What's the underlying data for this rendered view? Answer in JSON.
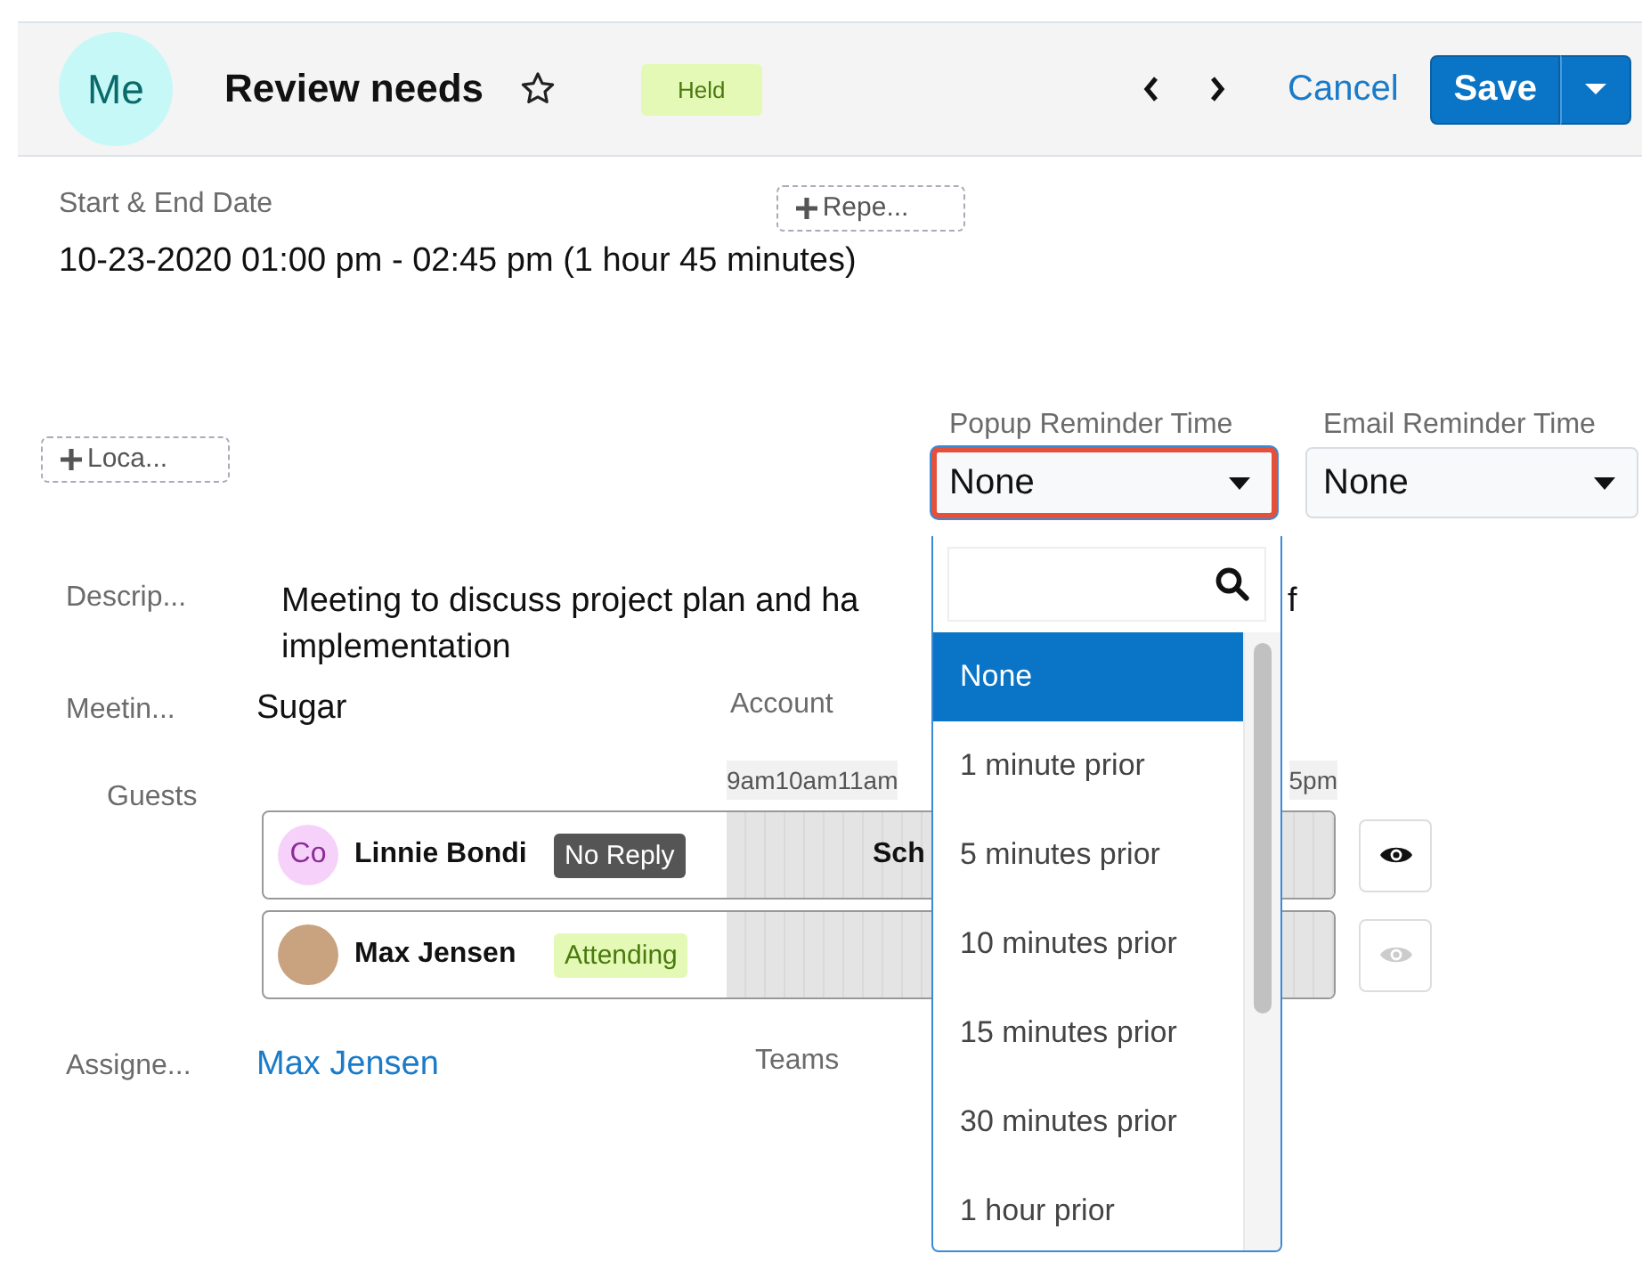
{
  "header": {
    "avatar": "Me",
    "title": "Review needs",
    "status": "Held",
    "cancel": "Cancel",
    "save": "Save"
  },
  "start_end": {
    "label": "Start & End Date",
    "value": "10-23-2020 01:00 pm - 02:45 pm (1 hour 45 minutes)"
  },
  "repeat_button": "Repe...",
  "location_button": "Loca...",
  "reminders": [
    {
      "label": "Popup Reminder Time",
      "value": "None",
      "highlighted": true
    },
    {
      "label": "Email Reminder Time",
      "value": "None",
      "highlighted": false
    }
  ],
  "dropdown": {
    "options": [
      {
        "label": "None",
        "selected": true
      },
      {
        "label": "1 minute prior",
        "selected": false
      },
      {
        "label": "5 minutes prior",
        "selected": false
      },
      {
        "label": "10 minutes prior",
        "selected": false
      },
      {
        "label": "15 minutes prior",
        "selected": false
      },
      {
        "label": "30 minutes prior",
        "selected": false
      },
      {
        "label": "1 hour prior",
        "selected": false
      }
    ]
  },
  "description": {
    "label": "Descrip...",
    "lines": [
      "Meeting to discuss project plan and ha",
      "implementation"
    ],
    "fragment": "f"
  },
  "meeting": {
    "label": "Meetin...",
    "value": "Sugar"
  },
  "account": {
    "label": "Account"
  },
  "guests": {
    "label": "Guests",
    "hours": [
      "9am",
      "10am",
      "11am"
    ],
    "hour_end": "5pm",
    "list": [
      {
        "kind": "initials",
        "initials": "Co",
        "name": "Linnie Bondi",
        "response": {
          "text": "No Reply",
          "kind": "no_reply"
        },
        "schedule": "Sch",
        "visible": true
      },
      {
        "kind": "photo",
        "name": "Max Jensen",
        "response": {
          "text": "Attending",
          "kind": "attending"
        },
        "visible": false
      }
    ]
  },
  "assigned": {
    "label": "Assigne...",
    "value": "Max Jensen"
  },
  "teams": {
    "label": "Teams"
  }
}
